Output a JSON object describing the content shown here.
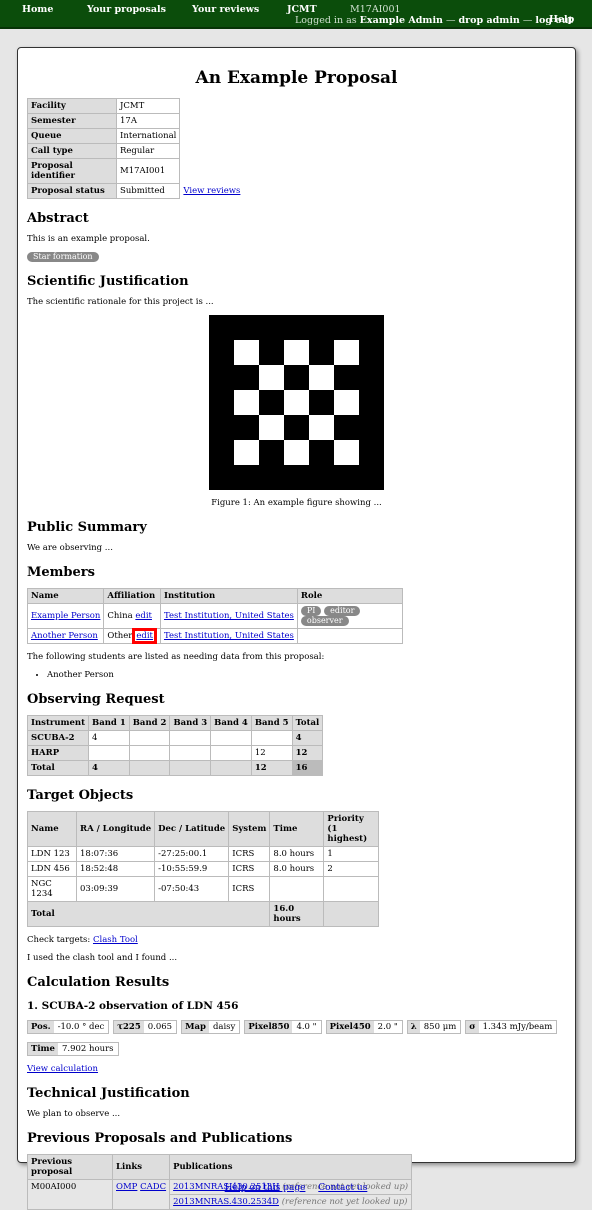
{
  "nav": {
    "home": "Home",
    "proposals": "Your proposals",
    "reviews": "Your reviews",
    "facility": "JCMT",
    "proposal_code": "M17AI001",
    "logged_in_prefix": "Logged in as",
    "user": "Example Admin",
    "sep1": "—",
    "drop_admin": "drop admin",
    "sep2": "—",
    "logout": "log out",
    "help": "Help"
  },
  "title": "An Example Proposal",
  "info": [
    {
      "label": "Facility",
      "value": "JCMT"
    },
    {
      "label": "Semester",
      "value": "17A"
    },
    {
      "label": "Queue",
      "value": "International"
    },
    {
      "label": "Call type",
      "value": "Regular"
    },
    {
      "label": "Proposal identifier",
      "value": "M17AI001"
    },
    {
      "label": "Proposal status",
      "value": "Submitted",
      "link": "View reviews"
    }
  ],
  "abstract": {
    "heading": "Abstract",
    "text": "This is an example proposal.",
    "category": "Star formation"
  },
  "sci_just": {
    "heading": "Scientific Justification",
    "text": "The scientific rationale for this project is ...",
    "caption": "Figure 1: An example figure showing ..."
  },
  "public_summary": {
    "heading": "Public Summary",
    "text": "We are observing ..."
  },
  "members": {
    "heading": "Members",
    "headers": [
      "Name",
      "Affiliation",
      "Institution",
      "Role"
    ],
    "rows": [
      {
        "name": "Example Person",
        "affiliation": "China",
        "edit": "edit",
        "institution": "Test Institution, United States",
        "roles": [
          "PI",
          "editor",
          "observer"
        ]
      },
      {
        "name": "Another Person",
        "affiliation": "Other",
        "edit": "edit",
        "institution": "Test Institution, United States",
        "roles": []
      }
    ],
    "students_note": "The following students are listed as needing data from this proposal:",
    "students": [
      "Another Person"
    ]
  },
  "observing": {
    "heading": "Observing Request",
    "headers": [
      "Instrument",
      "Band 1",
      "Band 2",
      "Band 3",
      "Band 4",
      "Band 5",
      "Total"
    ],
    "rows": [
      [
        "SCUBA-2",
        "4",
        "",
        "",
        "",
        "",
        "4"
      ],
      [
        "HARP",
        "",
        "",
        "",
        "",
        "12",
        "12"
      ]
    ],
    "total_row": [
      "Total",
      "4",
      "",
      "",
      "",
      "12",
      "16"
    ]
  },
  "targets": {
    "heading": "Target Objects",
    "headers": [
      "Name",
      "RA / Longitude",
      "Dec / Latitude",
      "System",
      "Time",
      "Priority"
    ],
    "priority_sub": "(1 highest)",
    "rows": [
      [
        "LDN 123",
        "18:07:36",
        "-27:25:00.1",
        "ICRS",
        "8.0 hours",
        "1"
      ],
      [
        "LDN 456",
        "18:52:48",
        "-10:55:59.9",
        "ICRS",
        "8.0 hours",
        "2"
      ],
      [
        "NGC 1234",
        "03:09:39",
        "-07:50:43",
        "ICRS",
        "",
        ""
      ]
    ],
    "total_label": "Total",
    "total_time": "16.0 hours",
    "check_label": "Check targets:",
    "clash_tool": "Clash Tool",
    "note": "I used the clash tool and I found ..."
  },
  "calc": {
    "heading": "Calculation Results",
    "subheading": "1. SCUBA-2 observation of LDN 456",
    "items": [
      {
        "k": "Pos.",
        "v": "-10.0 ° dec"
      },
      {
        "k": "τ225",
        "v": "0.065"
      },
      {
        "k": "Map",
        "v": "daisy"
      },
      {
        "k": "Pixel850",
        "v": "4.0 \""
      },
      {
        "k": "Pixel450",
        "v": "2.0 \""
      },
      {
        "k": "λ",
        "v": "850 μm"
      },
      {
        "k": "σ",
        "v": "1.343 mJy/beam"
      }
    ],
    "time_k": "Time",
    "time_v": "7.902 hours",
    "view_link": "View calculation"
  },
  "tech_just": {
    "heading": "Technical Justification",
    "text": "We plan to observe ..."
  },
  "prev": {
    "heading": "Previous Proposals and Publications",
    "headers": [
      "Previous proposal",
      "Links",
      "Publications"
    ],
    "proposal": "M00AI000",
    "links": [
      "OMP",
      "CADC"
    ],
    "pubs": [
      {
        "ref": "2013MNRAS.430.2513H",
        "note": "(reference not yet looked up)"
      },
      {
        "ref": "2013MNRAS.430.2534D",
        "note": "(reference not yet looked up)"
      }
    ]
  },
  "footer": {
    "help": "Help on this page",
    "contact": "Contact us"
  }
}
